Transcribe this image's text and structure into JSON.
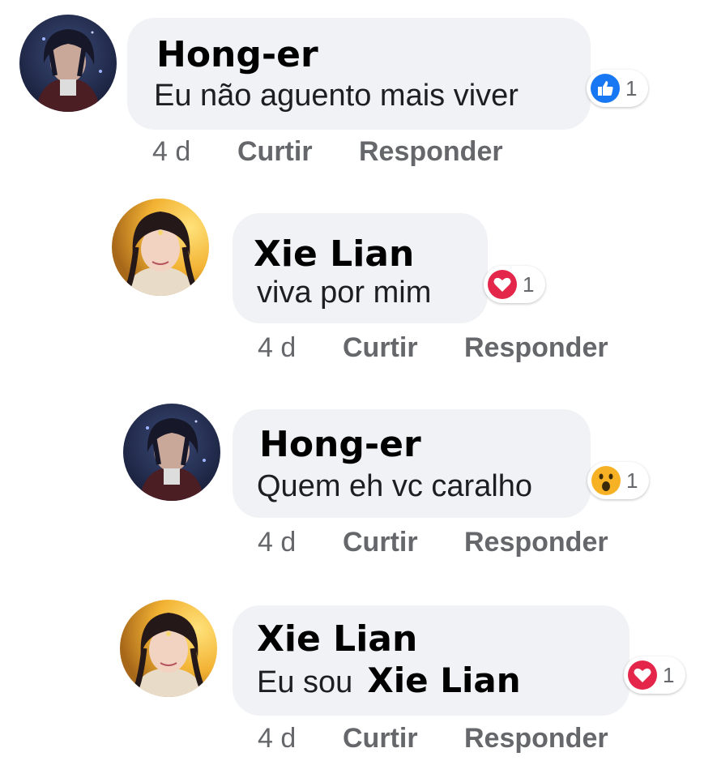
{
  "comments": [
    {
      "author": "Hong-er",
      "text": "Eu não aguento mais viver",
      "reaction": {
        "type": "like",
        "icon": "like-icon",
        "count": "1",
        "color": "#1877f2"
      },
      "time": "4 d",
      "like_label": "Curtir",
      "reply_label": "Responder",
      "avatar": "hong-er-avatar"
    },
    {
      "author": "Xie Lian",
      "text": "viva por mim",
      "reaction": {
        "type": "love",
        "icon": "heart-icon",
        "count": "1",
        "color": "#e4264a"
      },
      "time": "4 d",
      "like_label": "Curtir",
      "reply_label": "Responder",
      "avatar": "xie-lian-avatar"
    },
    {
      "author": "Hong-er",
      "text": "Quem eh vc caralho",
      "reaction": {
        "type": "wow",
        "icon": "wow-face-icon",
        "count": "1",
        "color": "#f7b125"
      },
      "time": "4 d",
      "like_label": "Curtir",
      "reply_label": "Responder",
      "avatar": "hong-er-avatar"
    },
    {
      "author": "Xie Lian",
      "text": "Eu sou",
      "mention": "Xie Lian",
      "reaction": {
        "type": "love",
        "icon": "heart-icon",
        "count": "1",
        "color": "#e4264a"
      },
      "time": "4 d",
      "like_label": "Curtir",
      "reply_label": "Responder",
      "avatar": "xie-lian-avatar"
    }
  ]
}
